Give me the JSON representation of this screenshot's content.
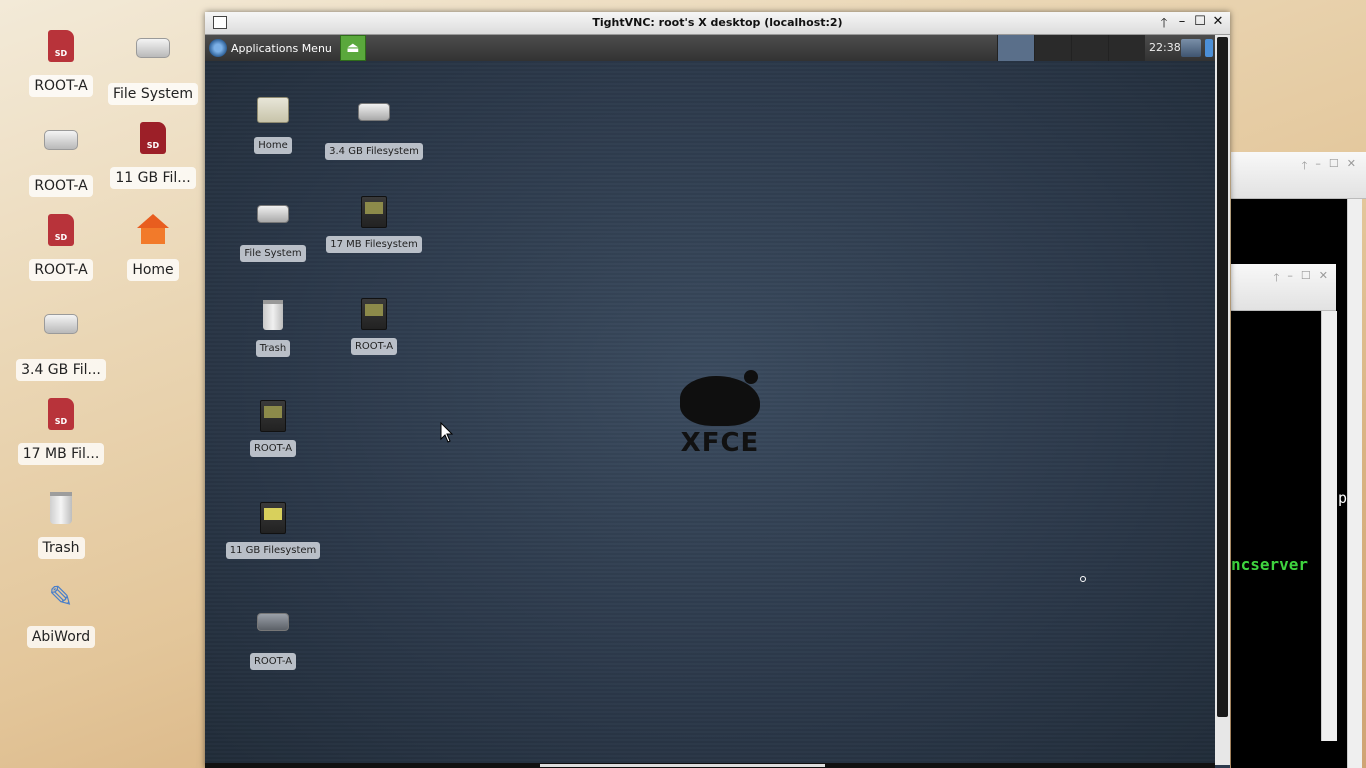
{
  "host_desktop": {
    "icons": [
      {
        "label": "ROOT-A",
        "icon": "sd-card-icon"
      },
      {
        "label": "File System",
        "icon": "hard-disk-icon"
      },
      {
        "label": "ROOT-A",
        "icon": "hard-disk-icon"
      },
      {
        "label": "11 GB Fil...",
        "icon": "sd-card-icon"
      },
      {
        "label": "ROOT-A",
        "icon": "sd-card-icon"
      },
      {
        "label": "Home",
        "icon": "home-icon"
      },
      {
        "label": "3.4 GB Fil...",
        "icon": "hard-disk-icon"
      },
      {
        "label": "17 MB Fil...",
        "icon": "sd-card-icon"
      },
      {
        "label": "Trash",
        "icon": "trash-icon"
      },
      {
        "label": "AbiWord",
        "icon": "abiword-icon"
      }
    ]
  },
  "vnc_window": {
    "title": "TightVNC: root's X desktop (localhost:2)",
    "controls": {
      "pin": "🡑",
      "minimize": "–",
      "maximize": "☐",
      "close": "✕"
    }
  },
  "xfce_panel": {
    "applications_menu": "Applications Menu",
    "clock": "22:38"
  },
  "remote_desktop": {
    "icons": [
      {
        "label": "Home",
        "icon": "home-folder-icon"
      },
      {
        "label": "3.4 GB Filesystem",
        "icon": "hard-disk-icon"
      },
      {
        "label": "File System",
        "icon": "hard-disk-icon"
      },
      {
        "label": "17 MB Filesystem",
        "icon": "flash-card-icon"
      },
      {
        "label": "Trash",
        "icon": "trash-icon"
      },
      {
        "label": "ROOT-A",
        "icon": "flash-card-icon"
      },
      {
        "label": "ROOT-A",
        "icon": "flash-card-icon"
      },
      {
        "label": "11 GB Filesystem",
        "icon": "flash-card-icon"
      },
      {
        "label": "ROOT-A",
        "icon": "hard-disk-icon"
      }
    ],
    "watermark": "XFCE"
  },
  "background_terminal": {
    "visible_text": "ncserver",
    "fragment_char": "p"
  }
}
